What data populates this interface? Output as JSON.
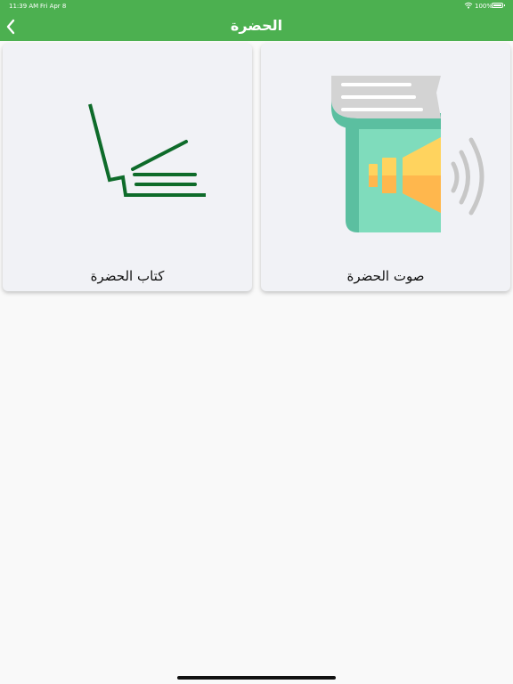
{
  "status_bar": {
    "time": "11:39 AM",
    "date": "Fri Apr 8",
    "battery": "100%"
  },
  "nav": {
    "title": "الحضرة",
    "back_icon": "chevron-left-icon"
  },
  "cards": [
    {
      "label": "كتاب الحضرة",
      "icon": "book-pen-icon",
      "icon_color": "#0e6b2a"
    },
    {
      "label": "صوت الحضرة",
      "icon": "audio-book-icon",
      "colors": {
        "cover": "#7fdcbc",
        "spine": "#5bbfa0",
        "pages": "#d3d3d3",
        "speaker": "#ffd35e",
        "speaker_shade": "#ffb74d",
        "waves": "#c7c7c7"
      }
    }
  ],
  "colors": {
    "accent": "#4cb050",
    "background": "#f9f9f9",
    "card": "#f1f2f6"
  }
}
